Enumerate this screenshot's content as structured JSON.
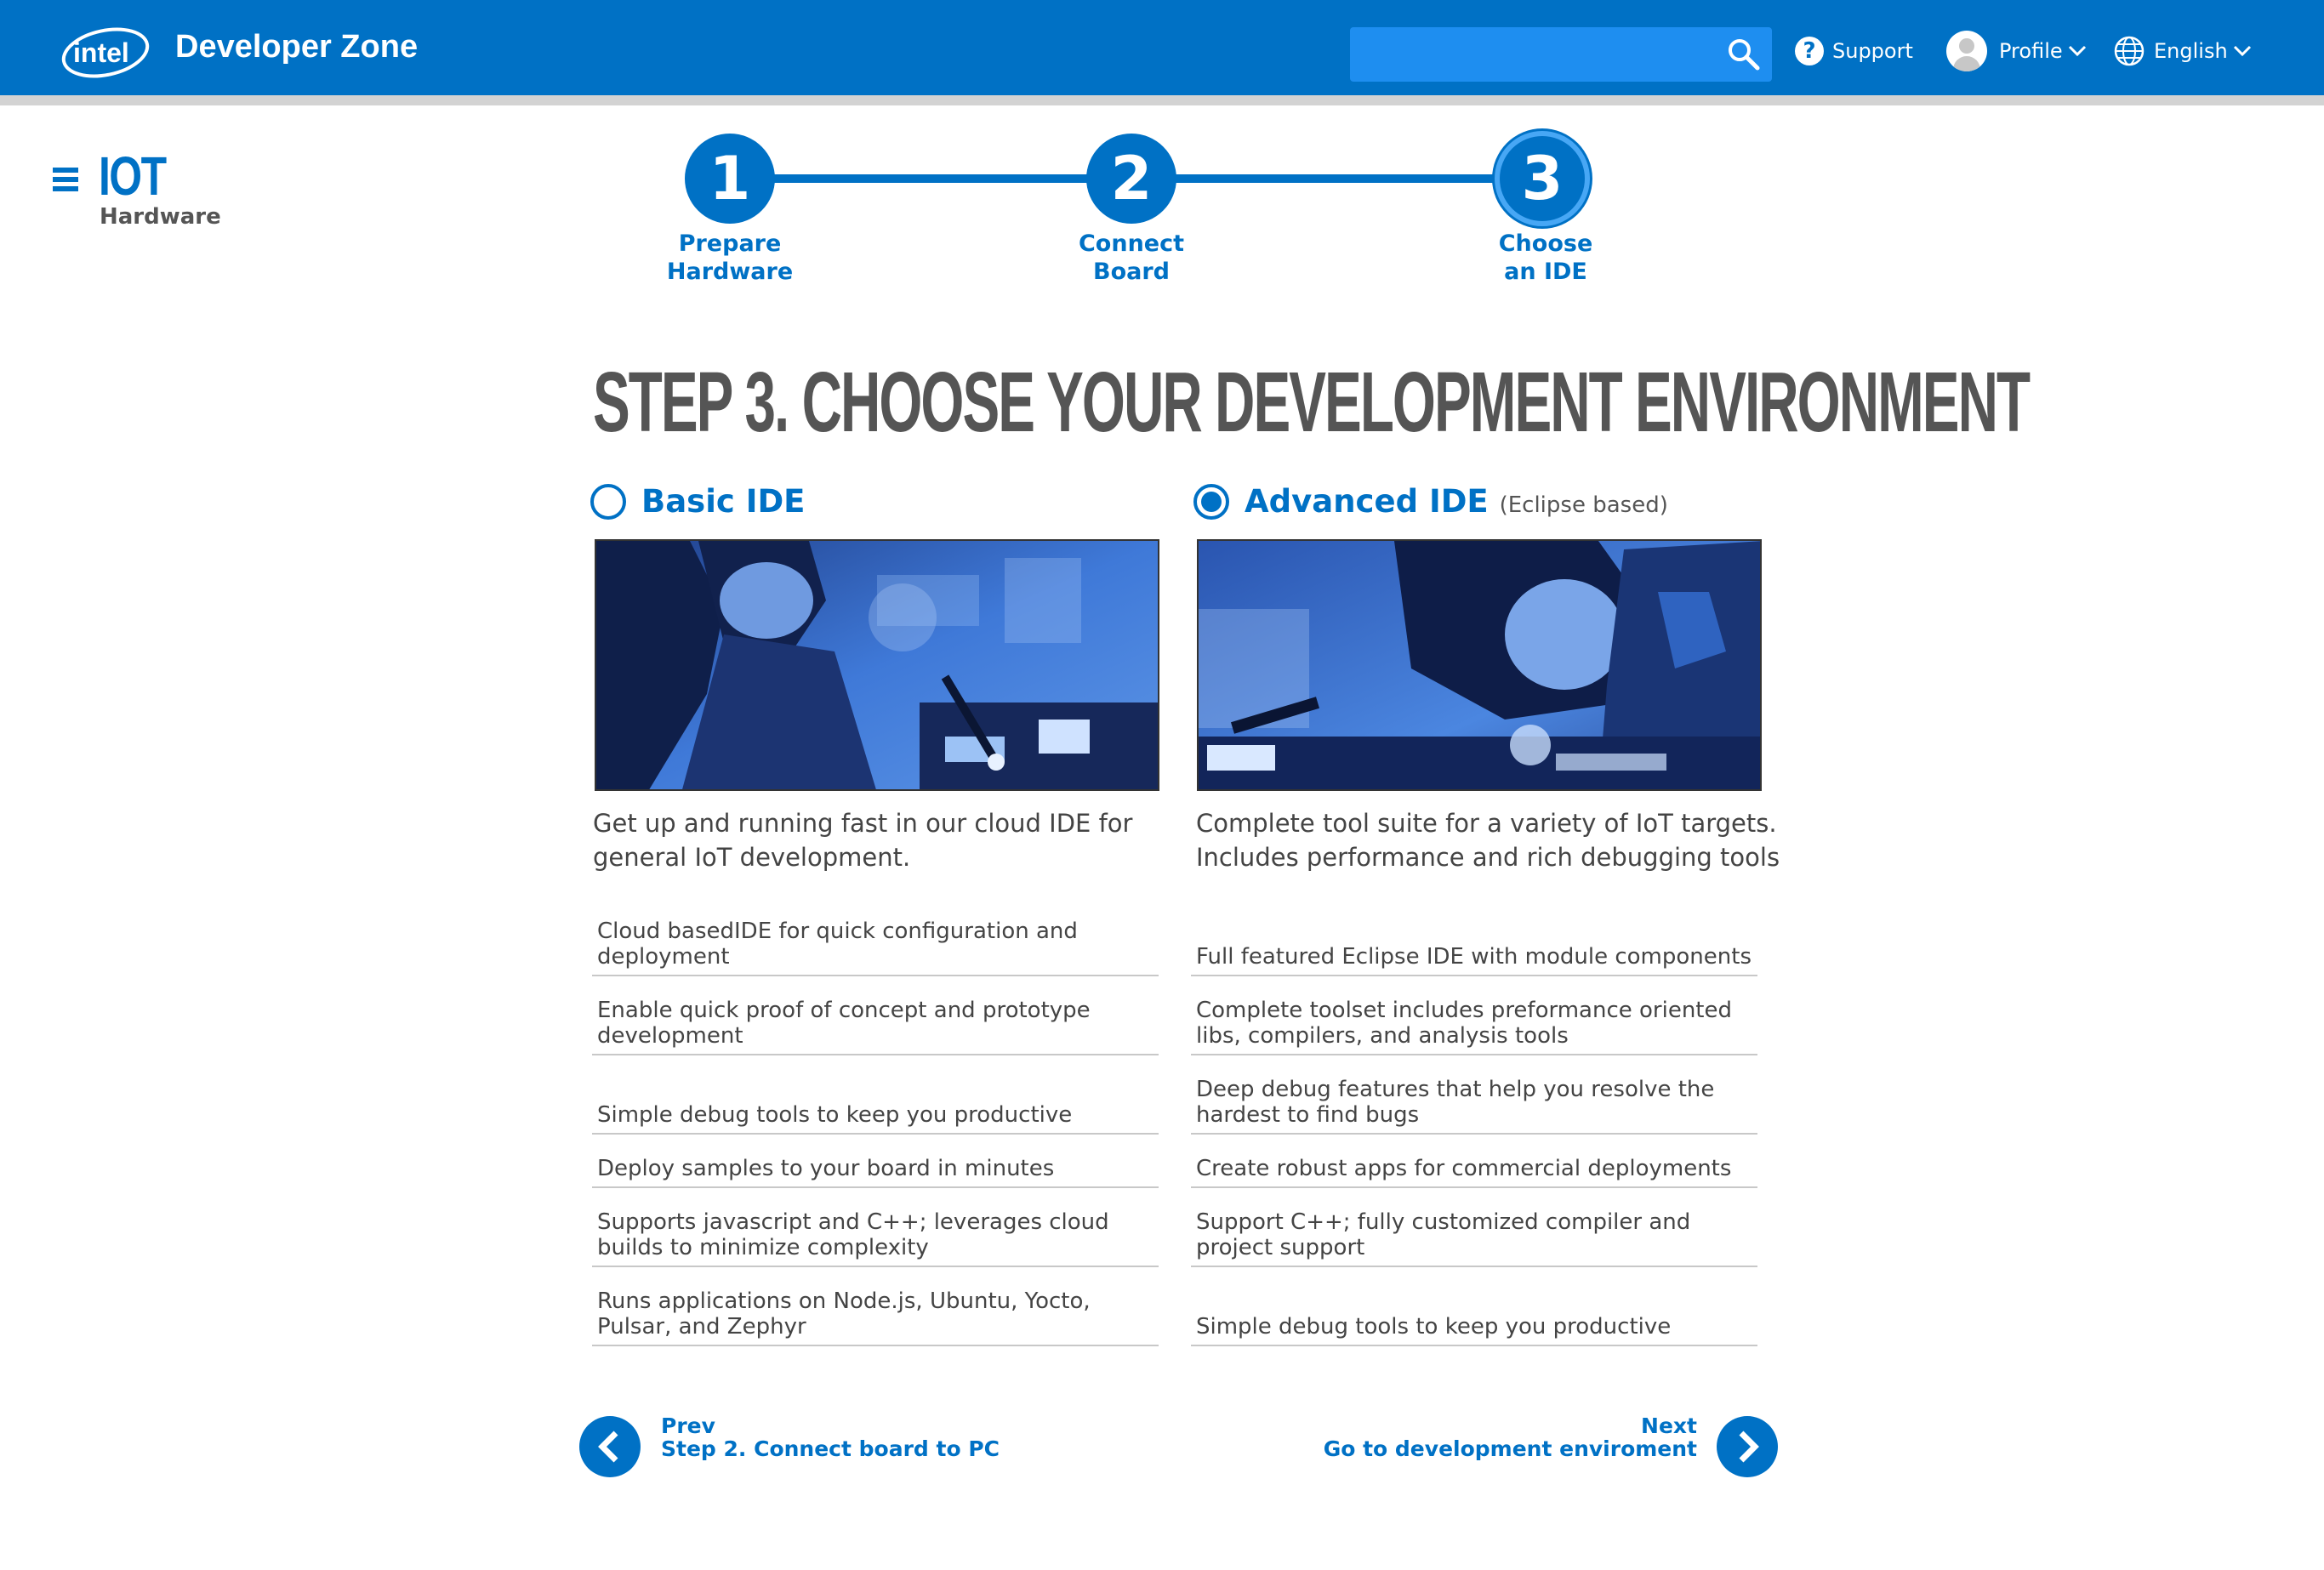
{
  "header": {
    "logo_text": "intel",
    "brand": "Developer Zone",
    "search_placeholder": "",
    "support_label": "Support",
    "profile_label": "Profile",
    "language_label": "English",
    "help_glyph": "?"
  },
  "sidebar": {
    "title": "IOT",
    "subtitle": "Hardware"
  },
  "stepper": {
    "steps": [
      {
        "number": "1",
        "label_line1": "Prepare",
        "label_line2": "Hardware"
      },
      {
        "number": "2",
        "label_line1": "Connect",
        "label_line2": "Board"
      },
      {
        "number": "3",
        "label_line1": "Choose",
        "label_line2": "an IDE"
      }
    ],
    "active_step": 3
  },
  "main": {
    "heading": "STEP 3. CHOOSE YOUR DEVELOPMENT ENVIRONMENT",
    "basic": {
      "title": "Basic IDE",
      "selected": false,
      "description": "Get up and running fast in our cloud IDE for general IoT development.",
      "features": [
        "Cloud basedIDE for quick configuration and deployment",
        "Enable quick proof of concept and prototype development",
        "Simple debug tools to keep you productive",
        "Deploy samples to your board in minutes",
        "Supports javascript and C++; leverages cloud builds to minimize complexity",
        "Runs applications on Node.js, Ubuntu, Yocto, Pulsar, and Zephyr"
      ]
    },
    "advanced": {
      "title": "Advanced IDE",
      "note": "(Eclipse based)",
      "selected": true,
      "description": "Complete tool suite for a variety of IoT targets. Includes performance and rich debugging tools",
      "features": [
        "Full featured Eclipse IDE with module components",
        "Complete toolset includes preformance oriented libs, compilers, and analysis tools",
        "Deep debug features that help you resolve the hardest to find bugs",
        "Create robust apps for commercial deployments",
        "Support C++; fully customized compiler and project support",
        "Simple debug tools to keep you productive"
      ]
    }
  },
  "footer_nav": {
    "prev_label": "Prev",
    "prev_target": "Step 2. Connect board to PC",
    "next_label": "Next",
    "next_target": "Go to development enviroment"
  },
  "colors": {
    "brand_blue": "#0071c5",
    "search_bg": "#1e8ef0",
    "heading_gray": "#555555"
  }
}
